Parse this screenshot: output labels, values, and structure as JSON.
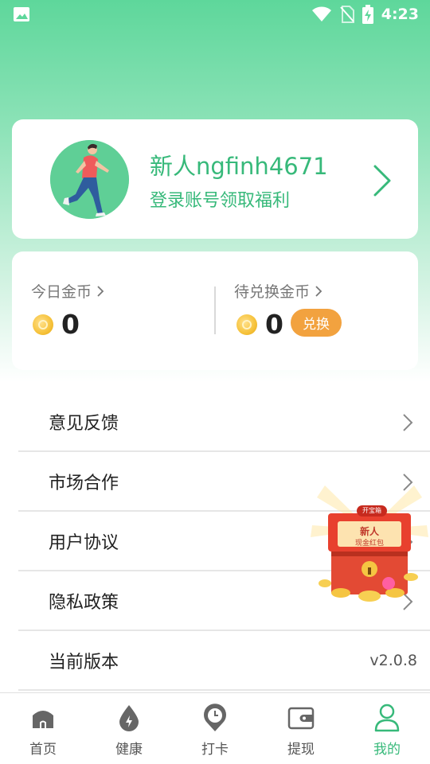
{
  "status_bar": {
    "time": "4:23",
    "icons": [
      "image-icon",
      "wifi-icon",
      "no-sim-icon",
      "battery-charging-icon"
    ]
  },
  "profile": {
    "nickname": "新人ngfinh4671",
    "login_hint": "登录账号领取福利",
    "accent_color": "#37b97a"
  },
  "coins": {
    "today_label": "今日金币",
    "today_value": "0",
    "pending_label": "待兑换金币",
    "pending_value": "0",
    "exchange_label": "兑换"
  },
  "menu": {
    "items": [
      {
        "label": "意见反馈"
      },
      {
        "label": "市场合作"
      },
      {
        "label": "用户协议"
      },
      {
        "label": "隐私政策"
      },
      {
        "label": "当前版本",
        "value": "v2.0.8"
      }
    ]
  },
  "red_packet": {
    "top_tag": "开宝箱",
    "title": "新人",
    "subtitle": "现金红包"
  },
  "bottom_nav": {
    "items": [
      {
        "label": "首页",
        "icon": "home-icon"
      },
      {
        "label": "健康",
        "icon": "water-drop-icon"
      },
      {
        "label": "打卡",
        "icon": "clock-pin-icon"
      },
      {
        "label": "提现",
        "icon": "wallet-icon"
      },
      {
        "label": "我的",
        "icon": "person-icon",
        "active": true
      }
    ],
    "active_color": "#37b97a"
  }
}
